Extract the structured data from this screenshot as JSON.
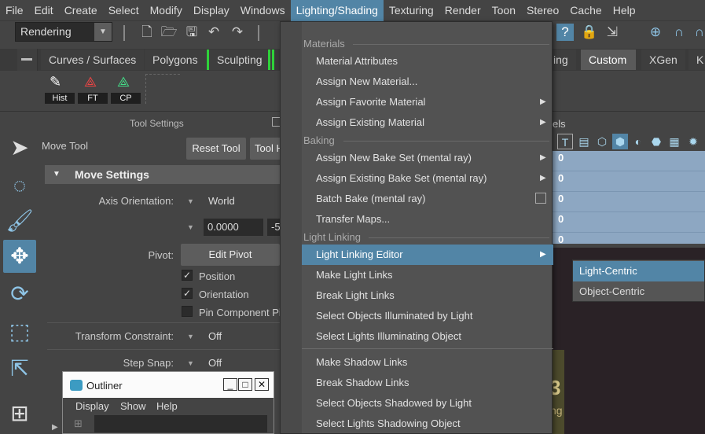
{
  "menubar": {
    "items": [
      "File",
      "Edit",
      "Create",
      "Select",
      "Modify",
      "Display",
      "Windows",
      "Lighting/Shading",
      "Texturing",
      "Render",
      "Toon",
      "Stereo",
      "Cache",
      "Help"
    ],
    "active": "Lighting/Shading"
  },
  "statusline": {
    "mode": "Rendering"
  },
  "shelf": {
    "tabs": [
      "Curves / Surfaces",
      "Polygons",
      "Sculpting",
      "ing",
      "Custom",
      "XGen",
      "K"
    ],
    "active_tab": "Custom",
    "buttons": [
      {
        "label": "Hist"
      },
      {
        "label": "FT"
      },
      {
        "label": "CP"
      }
    ]
  },
  "tool_settings": {
    "header": "Tool Settings",
    "tool_name": "Move Tool",
    "reset_button": "Reset Tool",
    "tool_help_button": "Tool H",
    "section": "Move Settings",
    "axis_orientation_label": "Axis Orientation:",
    "axis_orientation_value": "World",
    "coord_value": "0.0000",
    "coord_value2": "-5",
    "pivot_label": "Pivot:",
    "edit_pivot_button": "Edit Pivot",
    "checkboxes": [
      {
        "label": "Position",
        "checked": true
      },
      {
        "label": "Orientation",
        "checked": true
      },
      {
        "label": "Pin Component Pi",
        "checked": false
      }
    ],
    "transform_constraint_label": "Transform Constraint:",
    "transform_constraint_value": "Off",
    "step_snap_label": "Step Snap:",
    "step_snap_value": "Off"
  },
  "channel_box": {
    "title": "els",
    "values": [
      "0",
      "0",
      "0",
      "0",
      "0"
    ]
  },
  "outliner": {
    "title": "Outliner",
    "menu": [
      "Display",
      "Show",
      "Help"
    ]
  },
  "lighting_menu": {
    "sections": [
      {
        "heading": "Materials",
        "items": [
          {
            "label": "Material Attributes",
            "submenu": false
          },
          {
            "label": "Assign New Material...",
            "submenu": false
          },
          {
            "label": "Assign Favorite Material",
            "submenu": true
          },
          {
            "label": "Assign Existing Material",
            "submenu": true
          }
        ]
      },
      {
        "heading": "Baking",
        "items": [
          {
            "label": "Assign New Bake Set (mental ray)",
            "submenu": true
          },
          {
            "label": "Assign Existing Bake Set (mental ray)",
            "submenu": true
          },
          {
            "label": "Batch Bake (mental ray)",
            "option_box": true
          },
          {
            "label": "Transfer Maps...",
            "submenu": false
          }
        ]
      },
      {
        "heading": "Light Linking",
        "items": [
          {
            "label": "Light Linking Editor",
            "submenu": true,
            "highlighted": true
          },
          {
            "label": "Make Light Links"
          },
          {
            "label": "Break Light Links"
          },
          {
            "label": "Select Objects Illuminated by Light"
          },
          {
            "label": "Select Lights Illuminating Object"
          }
        ]
      },
      {
        "heading": "",
        "items": [
          {
            "label": "Make Shadow Links"
          },
          {
            "label": "Break Shadow Links"
          },
          {
            "label": "Select Objects Shadowed by Light"
          },
          {
            "label": "Select Lights Shadowing Object"
          }
        ]
      }
    ]
  },
  "light_linking_submenu": {
    "items": [
      "Light-Centric",
      "Object-Centric"
    ],
    "highlighted": "Light-Centric"
  },
  "viewport": {
    "text_big": "3",
    "text_small": "ng"
  },
  "colors": {
    "highlight": "#5285a6",
    "bracket_green": "#2fd23a",
    "channel_blue": "#8da7c2"
  }
}
